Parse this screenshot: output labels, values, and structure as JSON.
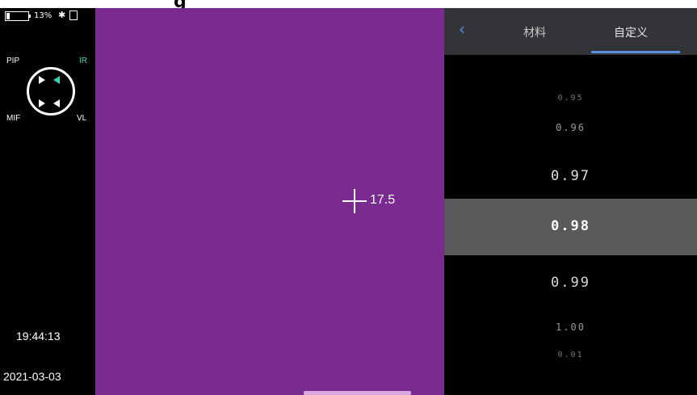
{
  "top_cut_text": "g",
  "status": {
    "battery": "13%",
    "battery_level": 0.13,
    "bluetooth": "✱"
  },
  "view_modes": {
    "pip": "PIP",
    "ir": "IR",
    "mif": "MIF",
    "vl": "VL"
  },
  "clock": {
    "time": "19:44:13",
    "date": "2021-03-03"
  },
  "thermal": {
    "spot_temp": "17.5",
    "background": "#7a2b8f"
  },
  "tabs": {
    "back": "‹",
    "material": "材料",
    "custom": "自定义"
  },
  "emissivity": {
    "values": [
      "0.95",
      "0.96",
      "0.97",
      "0.98",
      "0.99",
      "1.00",
      "0.01"
    ],
    "selected": "0.98"
  },
  "colors": {
    "accent": "#5b8fe0",
    "ir_active": "#3ccfb2"
  }
}
